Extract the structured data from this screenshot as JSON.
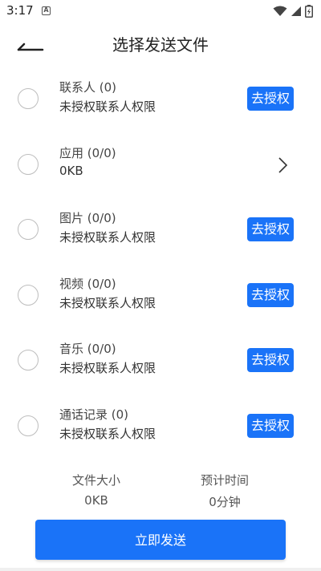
{
  "status_bar": {
    "time": "3:17",
    "notification_letter": "A"
  },
  "header": {
    "title": "选择发送文件",
    "back_icon": "back-arrow-icon"
  },
  "items": [
    {
      "title": "联系人  (0)",
      "subtitle": "未授权联系人权限",
      "action": "去授权"
    },
    {
      "title": "应用  (0/0)",
      "subtitle": "0KB",
      "action": ""
    },
    {
      "title": "图片  (0/0)",
      "subtitle": "未授权联系人权限",
      "action": "去授权"
    },
    {
      "title": "视频  (0/0)",
      "subtitle": "未授权联系人权限",
      "action": "去授权"
    },
    {
      "title": "音乐  (0/0)",
      "subtitle": "未授权联系人权限",
      "action": "去授权"
    },
    {
      "title": "通话记录  (0)",
      "subtitle": "未授权联系人权限",
      "action": "去授权"
    }
  ],
  "summary": {
    "size_label": "文件大小",
    "size_value": "0KB",
    "time_label": "预计时间",
    "time_value": "0分钟"
  },
  "send_button": "立即发送",
  "colors": {
    "accent": "#1a73f8",
    "radio_border": "#bdbdbd"
  }
}
